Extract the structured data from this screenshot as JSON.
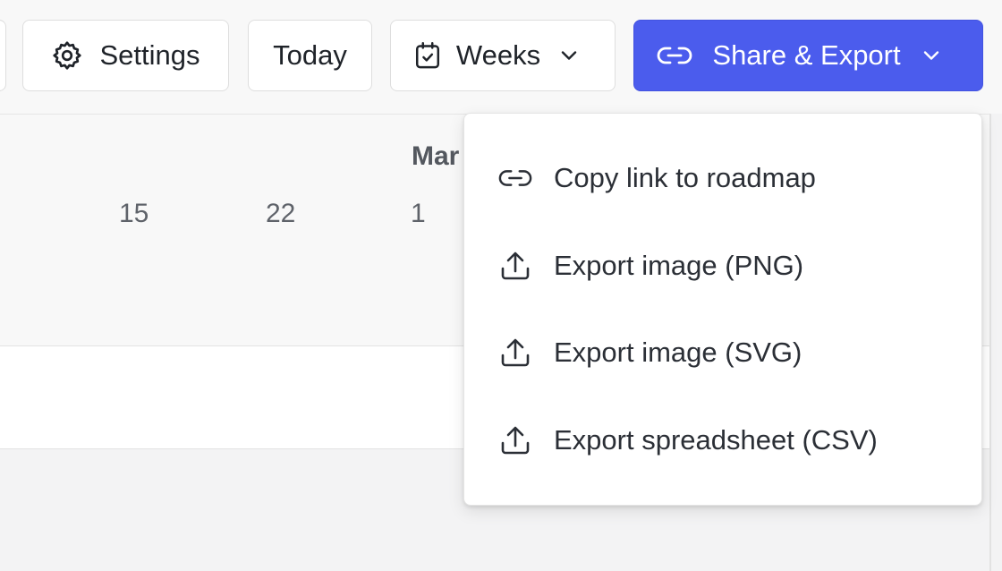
{
  "toolbar": {
    "settings_label": "Settings",
    "today_label": "Today",
    "view_label": "Weeks",
    "share_label": "Share & Export",
    "share_color": "#4b5ced"
  },
  "timeline": {
    "month_label": "Mar",
    "week_labels": [
      "15",
      "22",
      "1"
    ]
  },
  "share_menu": {
    "items": [
      {
        "label": "Copy link to roadmap",
        "icon": "link-icon"
      },
      {
        "label": "Export image (PNG)",
        "icon": "upload-icon"
      },
      {
        "label": "Export image (SVG)",
        "icon": "upload-icon"
      },
      {
        "label": "Export spreadsheet (CSV)",
        "icon": "upload-icon"
      }
    ]
  }
}
